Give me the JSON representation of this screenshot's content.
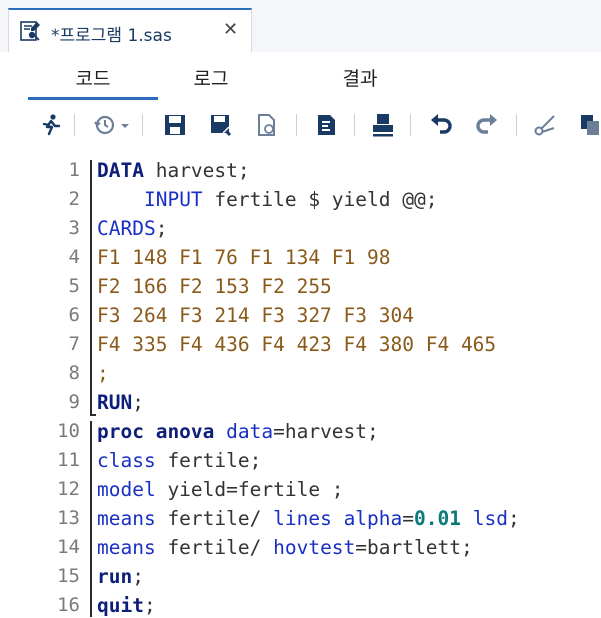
{
  "tab": {
    "title": "*프로그램 1.sas",
    "close": "✕"
  },
  "subtabs": [
    "코드",
    "로그",
    "결과"
  ],
  "toolbar_icons": [
    "run-icon",
    "history-icon",
    "save-icon",
    "save-as-icon",
    "open-icon",
    "format-icon",
    "print-icon",
    "undo-icon",
    "redo-icon",
    "cut-icon",
    "copy-icon"
  ],
  "colors": {
    "keyword": "#0d1f78",
    "statement": "#1a2fc4",
    "data_line": "#8a5a1a",
    "number": "#0a7a7a",
    "accent": "#2a6ebb"
  },
  "line_numbers": [
    "1",
    "2",
    "3",
    "4",
    "5",
    "6",
    "7",
    "8",
    "9",
    "10",
    "11",
    "12",
    "13",
    "14",
    "15",
    "16"
  ],
  "code": {
    "l1": {
      "kw": "DATA",
      "rest": " harvest;"
    },
    "l2": {
      "indent": "    ",
      "kw": "INPUT",
      "rest": " fertile $ yield @@;"
    },
    "l3": {
      "kw": "CARDS",
      "rest": ";"
    },
    "l4": "F1 148 F1 76 F1 134 F1 98",
    "l5": "F2 166 F2 153 F2 255",
    "l6": "F3 264 F3 214 F3 327 F3 304",
    "l7": "F4 335 F4 436 F4 423 F4 380 F4 465",
    "l8": ";",
    "l9": {
      "kw": "RUN",
      "rest": ";"
    },
    "l10": {
      "kw1": "proc anova",
      "kw2": " data",
      "rest": "=harvest;"
    },
    "l11": {
      "kw": "class",
      "rest": " fertile;"
    },
    "l12": {
      "kw": "model",
      "rest": " yield=fertile ;"
    },
    "l13": {
      "kw": "means",
      "mid1": " fertile/ ",
      "kw2": "lines",
      "sp": " ",
      "kw3": "alpha",
      "eq": "=",
      "num": "0.01",
      "sp2": " ",
      "kw4": "lsd",
      "end": ";"
    },
    "l14": {
      "kw": "means",
      "mid": " fertile/ ",
      "kw2": "hovtest",
      "rest": "=bartlett;"
    },
    "l15": {
      "kw": "run",
      "rest": ";"
    },
    "l16": {
      "kw": "quit",
      "rest": ";"
    }
  }
}
